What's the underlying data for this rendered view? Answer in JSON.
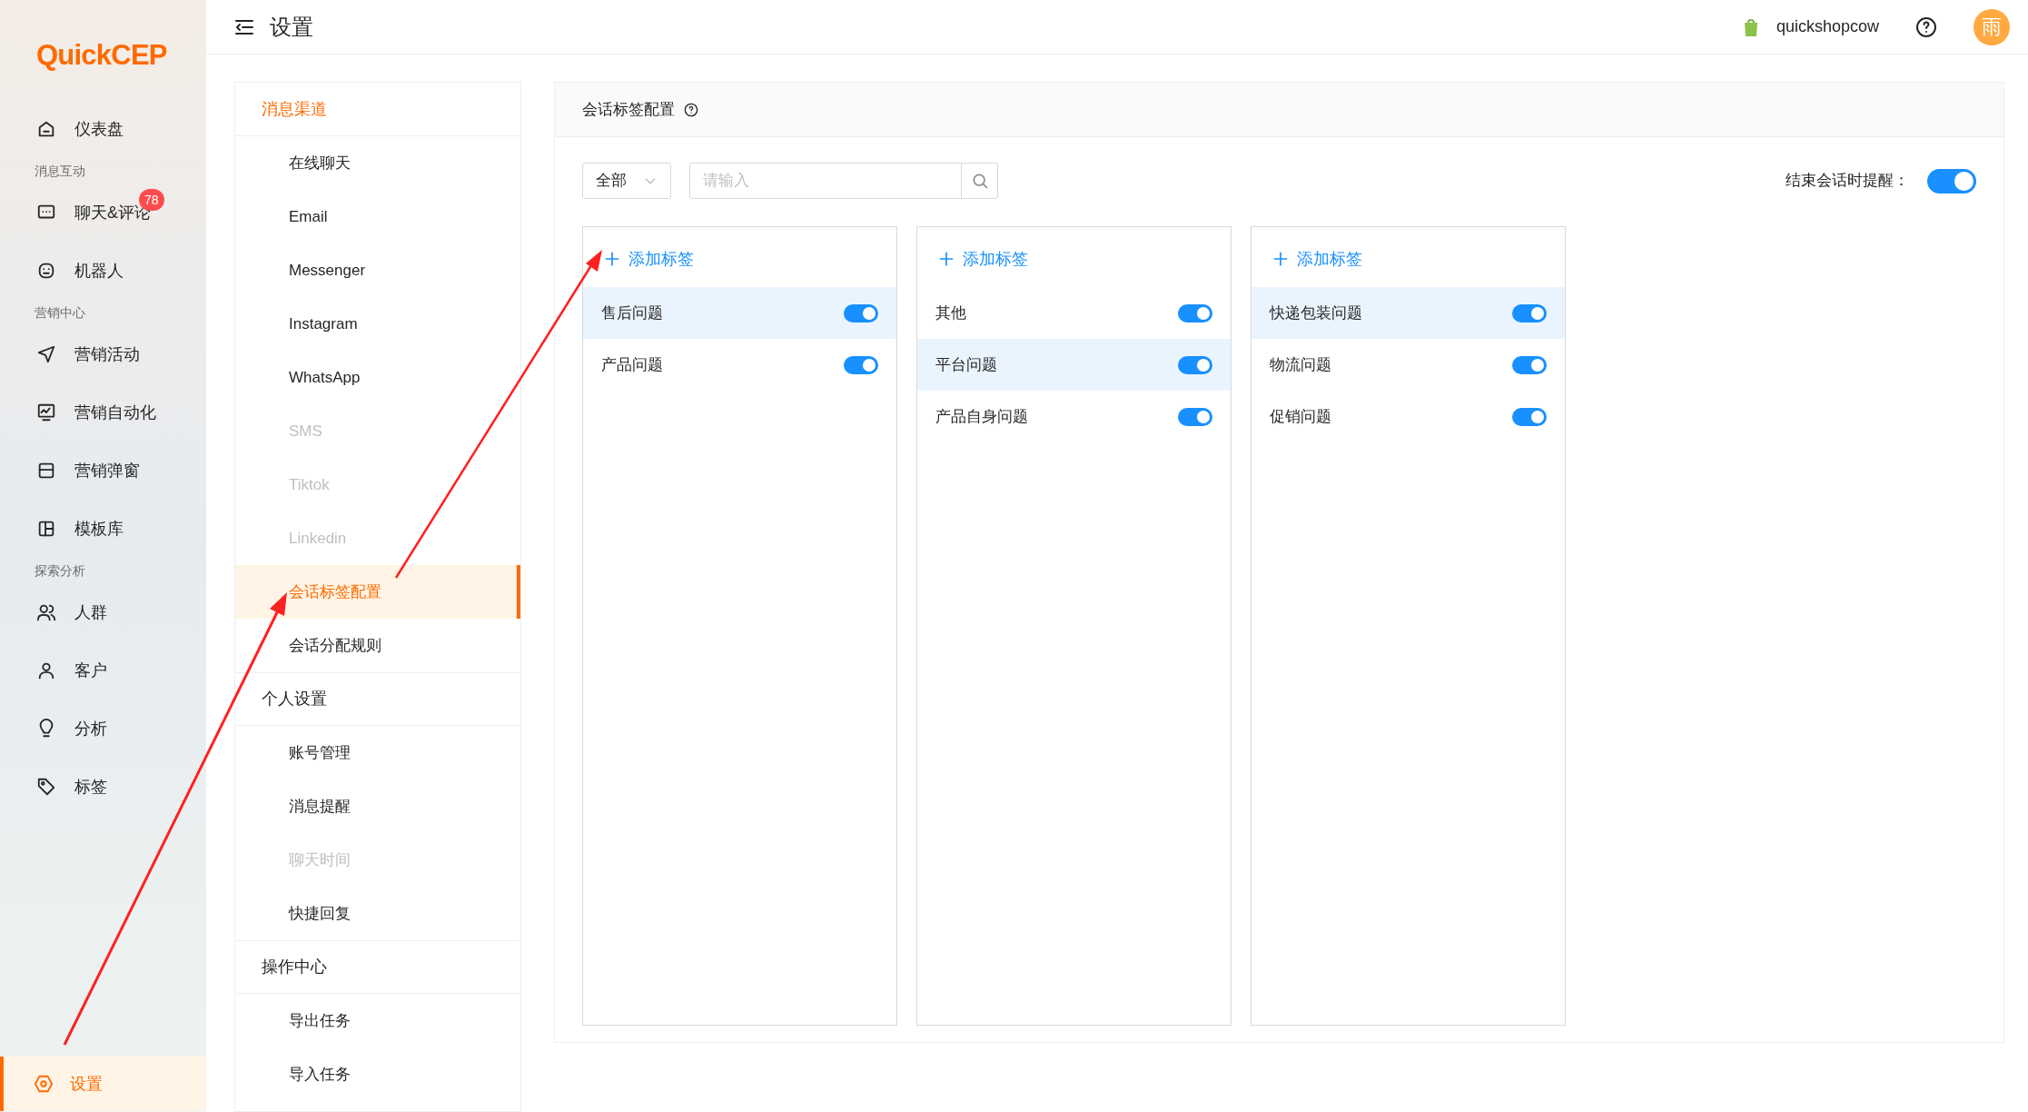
{
  "logo": {
    "text": "QuickCEP"
  },
  "sidebar": {
    "items": [
      {
        "kind": "item",
        "label": "仪表盘",
        "selected": false
      },
      {
        "kind": "section",
        "label": "消息互动"
      },
      {
        "kind": "item",
        "label": "聊天&评论",
        "badge": "78",
        "selected": false
      },
      {
        "kind": "item",
        "label": "机器人",
        "selected": false
      },
      {
        "kind": "section",
        "label": "营销中心"
      },
      {
        "kind": "item",
        "label": "营销活动",
        "selected": false
      },
      {
        "kind": "item",
        "label": "营销自动化",
        "selected": false
      },
      {
        "kind": "item",
        "label": "营销弹窗",
        "selected": false
      },
      {
        "kind": "item",
        "label": "模板库",
        "selected": false
      },
      {
        "kind": "section",
        "label": "探索分析"
      },
      {
        "kind": "item",
        "label": "人群",
        "selected": false
      },
      {
        "kind": "item",
        "label": "客户",
        "selected": false
      },
      {
        "kind": "item",
        "label": "分析",
        "selected": false
      },
      {
        "kind": "item",
        "label": "标签",
        "selected": false
      }
    ],
    "footer": {
      "label": "设置",
      "selected": true
    }
  },
  "header": {
    "title": "设置",
    "shop": "quickshopcow",
    "avatar": "雨"
  },
  "settings_menu": [
    {
      "label": "消息渠道",
      "highlighted": true,
      "children": [
        {
          "label": "在线聊天",
          "disabled": false,
          "selected": false
        },
        {
          "label": "Email",
          "disabled": false,
          "selected": false
        },
        {
          "label": "Messenger",
          "disabled": false,
          "selected": false
        },
        {
          "label": "Instagram",
          "disabled": false,
          "selected": false
        },
        {
          "label": "WhatsApp",
          "disabled": false,
          "selected": false
        },
        {
          "label": "SMS",
          "disabled": true,
          "selected": false
        },
        {
          "label": "Tiktok",
          "disabled": true,
          "selected": false
        },
        {
          "label": "Linkedin",
          "disabled": true,
          "selected": false
        },
        {
          "label": "会话标签配置",
          "disabled": false,
          "selected": true
        },
        {
          "label": "会话分配规则",
          "disabled": false,
          "selected": false
        }
      ]
    },
    {
      "label": "个人设置",
      "highlighted": false,
      "children": [
        {
          "label": "账号管理",
          "disabled": false,
          "selected": false
        },
        {
          "label": "消息提醒",
          "disabled": false,
          "selected": false
        },
        {
          "label": "聊天时间",
          "disabled": true,
          "selected": false
        },
        {
          "label": "快捷回复",
          "disabled": false,
          "selected": false
        }
      ]
    },
    {
      "label": "操作中心",
      "highlighted": false,
      "children": [
        {
          "label": "导出任务",
          "disabled": false,
          "selected": false
        },
        {
          "label": "导入任务",
          "disabled": false,
          "selected": false
        }
      ]
    }
  ],
  "panel": {
    "title": "会话标签配置",
    "filter": {
      "value": "全部"
    },
    "search": {
      "placeholder": "请输入"
    },
    "end_reminder": {
      "label": "结束会话时提醒：",
      "on": true
    },
    "columns": [
      {
        "add_label": "添加标签",
        "tags": [
          {
            "label": "售后问题",
            "on": true,
            "selected": true
          },
          {
            "label": "产品问题",
            "on": true,
            "selected": false
          }
        ]
      },
      {
        "add_label": "添加标签",
        "tags": [
          {
            "label": "其他",
            "on": true,
            "selected": false
          },
          {
            "label": "平台问题",
            "on": true,
            "selected": true
          },
          {
            "label": "产品自身问题",
            "on": true,
            "selected": false
          }
        ]
      },
      {
        "add_label": "添加标签",
        "tags": [
          {
            "label": "快递包装问题",
            "on": true,
            "selected": true
          },
          {
            "label": "物流问题",
            "on": true,
            "selected": false
          },
          {
            "label": "促销问题",
            "on": true,
            "selected": false
          }
        ]
      }
    ]
  }
}
